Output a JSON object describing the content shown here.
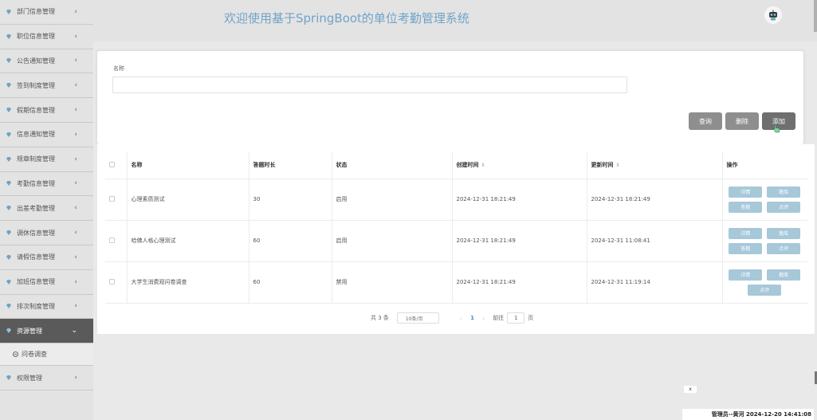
{
  "header": {
    "title": "欢迎使用基于SpringBoot的单位考勤管理系统",
    "avatar_icon": "robot-avatar-icon"
  },
  "sidebar": {
    "items": [
      {
        "label": "部门信息管理"
      },
      {
        "label": "职位信息管理"
      },
      {
        "label": "公告通知管理"
      },
      {
        "label": "签到制度管理"
      },
      {
        "label": "假期信息管理"
      },
      {
        "label": "信息通知管理"
      },
      {
        "label": "规章制度管理"
      },
      {
        "label": "考勤信息管理"
      },
      {
        "label": "出差考勤管理"
      },
      {
        "label": "调休信息管理"
      },
      {
        "label": "请假信息管理"
      },
      {
        "label": "加班信息管理"
      },
      {
        "label": "排次制度管理"
      },
      {
        "label": "资源管理"
      },
      {
        "label": "权限管理"
      }
    ],
    "sub_item": "问卷调查",
    "accent": "#6fa4c9"
  },
  "search": {
    "label": "名称",
    "value": "",
    "query_label": "查询",
    "delete_label": "删除",
    "add_label": "添加"
  },
  "table": {
    "columns": [
      "名称",
      "答题时长",
      "状态",
      "创建时间",
      "更新时间",
      "操作"
    ],
    "rows": [
      {
        "name": "心理素质测试",
        "duration": "30",
        "status": "启用",
        "created": "2024-12-31 18:21:49",
        "updated": "2024-12-31 18:21:49",
        "ops": [
          "详情",
          "题库",
          "答题",
          "点评"
        ]
      },
      {
        "name": "哈佛人格心理测试",
        "duration": "60",
        "status": "启用",
        "created": "2024-12-31 18:21:49",
        "updated": "2024-12-31 11:08:41",
        "ops": [
          "详情",
          "题库",
          "答题",
          "点评"
        ]
      },
      {
        "name": "大学生消费观问卷调查",
        "duration": "60",
        "status": "禁用",
        "created": "2024-12-31 18:21:49",
        "updated": "2024-12-31 11:19:14",
        "ops": [
          "详情",
          "题库",
          "点评"
        ]
      }
    ]
  },
  "pagination": {
    "total": "共 3 条",
    "page_size": "10条/页",
    "current": "1",
    "goto_prefix": "前往",
    "goto_value": "1",
    "goto_suffix": "页"
  },
  "toast": {
    "close": "x"
  },
  "status_bar": {
    "text": "管理员--黄河 2024-12-20 14:41:08"
  }
}
